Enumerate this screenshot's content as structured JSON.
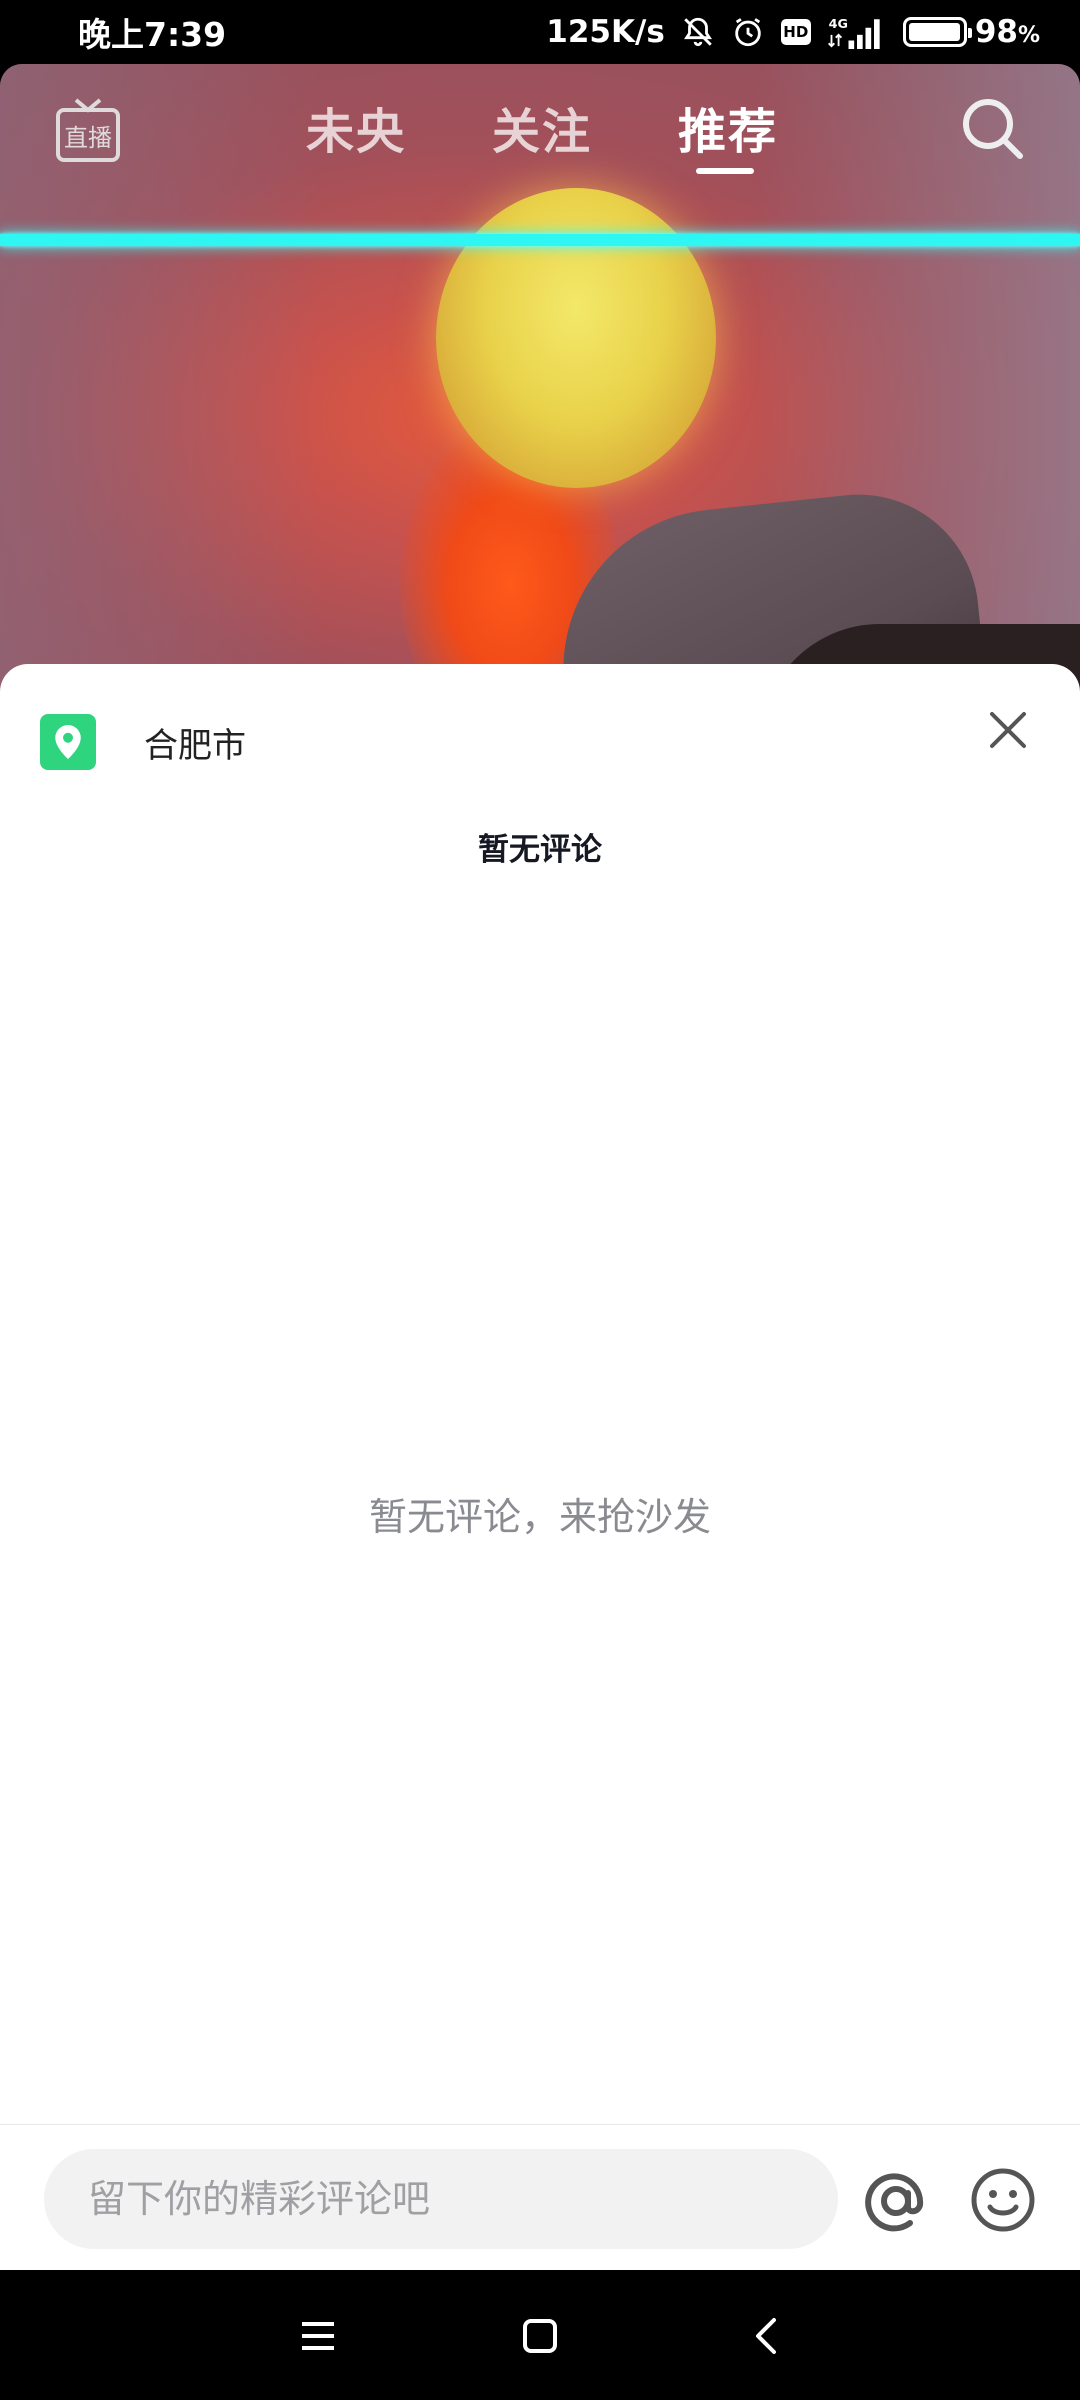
{
  "status_bar": {
    "time": "晚上7:39",
    "network_speed": "125K/s",
    "hd_label": "HD",
    "signal_label": "4G",
    "battery_percent": "98",
    "battery_unit": "%",
    "battery_level": 0.98
  },
  "top_nav": {
    "live_icon": "live-tv-icon",
    "tabs": [
      {
        "label": "未央",
        "active": false
      },
      {
        "label": "关注",
        "active": false
      },
      {
        "label": "推荐",
        "active": true
      }
    ],
    "search_icon": "search-icon"
  },
  "comment_sheet": {
    "location": "合肥市",
    "title": "暂无评论",
    "empty_message": "暂无评论，来抢沙发",
    "input_placeholder": "留下你的精彩评论吧",
    "at_icon": "at-icon",
    "emoji_icon": "emoji-icon",
    "close_icon": "close-icon"
  },
  "colors": {
    "location_badge": "#2fd47e",
    "scanline": "#2ef6f2"
  }
}
